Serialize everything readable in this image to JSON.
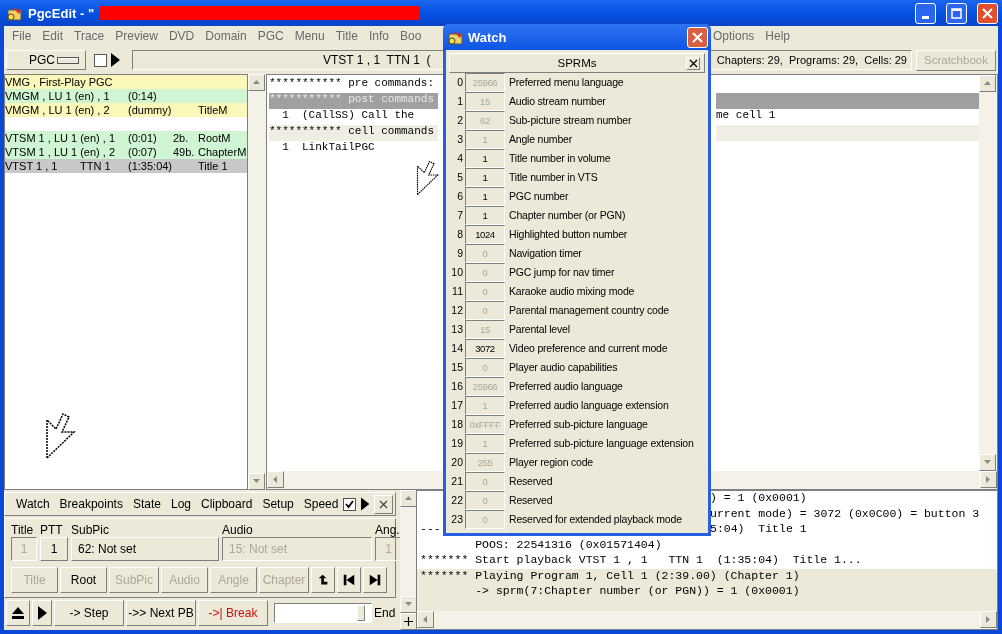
{
  "window": {
    "title": "PgcEdit - \"",
    "redacted": true
  },
  "menu": {
    "items": [
      "File",
      "Edit",
      "Trace",
      "Preview",
      "DVD",
      "Domain",
      "PGC",
      "Menu",
      "Title",
      "Info",
      "Boo"
    ],
    "items_right": [
      "Options",
      "Help"
    ]
  },
  "toolbar": {
    "domain_select": "PGC",
    "checked": false,
    "location": "VTST 1 , 1  TTN 1  (",
    "summary": "Chapters: 29,  Programs: 29,  Cells: 29",
    "scratchbook": {
      "label": "Scratchbook",
      "disabled": true
    }
  },
  "pgc_list": [
    {
      "name": "VMG , First-Play PGC",
      "color": "#fbf7b8",
      "selected": false
    },
    {
      "name": "VMGM , LU 1 (en) , 1",
      "duration": "(0:14)",
      "color": "#cff5d2",
      "selected": false
    },
    {
      "name": "VMGM , LU 1 (en) , 2",
      "duration": "(dummy)",
      "label": "TitleM",
      "color": "#fbf7b8",
      "selected": false
    },
    {
      "name": "VTSM 1 , LU 1 (en) , 1",
      "duration": "(0:01)",
      "size": "2b.",
      "label": "RootM",
      "color": "#cff5d2",
      "selected": false,
      "gap_before": true
    },
    {
      "name": "VTSM 1 , LU 1 (en) , 2",
      "duration": "(0:07)",
      "size": "49b.",
      "label": "ChapterM",
      "color": "#cff5d2",
      "selected": false
    },
    {
      "name": "VTST 1 , 1",
      "ttn": "TTN 1",
      "duration": "(1:35:04)",
      "label": "Title 1",
      "selected": true
    }
  ],
  "commands": [
    {
      "text": "*********** pre commands:",
      "selected": false,
      "current": false
    },
    {
      "text": "*********** post commands",
      "selected": true,
      "current": false
    },
    {
      "text": "  1  (CallSS) Call the",
      "text_right": "me cell 1",
      "selected": false,
      "current": false
    },
    {
      "text": "*********** cell commands",
      "selected": false,
      "current": true
    },
    {
      "text": "  1  LinkTailPGC",
      "selected": false,
      "current": false
    }
  ],
  "control_panel": {
    "tabs": [
      "Watch",
      "Breakpoints",
      "State",
      "Log",
      "Clipboard",
      "Setup",
      "Speed"
    ],
    "auto_checked": true,
    "fields": [
      {
        "label": "Title",
        "value": "1",
        "disabled": true
      },
      {
        "label": "PTT",
        "value": "1",
        "disabled": false
      },
      {
        "label": "SubPic",
        "value": "62: Not set",
        "disabled": false
      },
      {
        "label": "Audio",
        "value": "15: Not set",
        "disabled": true
      },
      {
        "label": "Ang.",
        "value": "1",
        "disabled": true
      }
    ],
    "buttons": [
      {
        "kind": "text",
        "label": "Title",
        "disabled": true
      },
      {
        "kind": "text",
        "label": "Root",
        "disabled": false
      },
      {
        "kind": "text",
        "label": "SubPic",
        "disabled": true
      },
      {
        "kind": "text",
        "label": "Audio",
        "disabled": true
      },
      {
        "kind": "text",
        "label": "Angle",
        "disabled": true
      },
      {
        "kind": "text",
        "label": "Chapter",
        "disabled": true
      },
      {
        "kind": "return",
        "disabled": false
      },
      {
        "kind": "prev",
        "disabled": false
      },
      {
        "kind": "next",
        "disabled": false
      }
    ],
    "transport": [
      {
        "kind": "eject"
      },
      {
        "kind": "play"
      },
      {
        "kind": "text",
        "label": "-> Step"
      },
      {
        "kind": "text",
        "label": "->> Next PB"
      },
      {
        "kind": "break",
        "label": "->| Break"
      }
    ],
    "speed": {
      "level": 0.93,
      "label": "End"
    }
  },
  "log": [
    {
      "text_right": ") = 1 (0x0001)",
      "current": false
    },
    {
      "text_right": "urrent mode) = 3072 (0x0C00) = button 3",
      "current": false
    },
    {
      "text": "---",
      "text_right": "5:04)  Title 1",
      "current": false
    },
    {
      "text": "        POOS: 22541316 (0x01571404)",
      "current": false
    },
    {
      "text": "******* Start playback VTST 1 , 1   TTN 1  (1:35:04)  Title 1...",
      "current": false
    },
    {
      "text": "******* Playing Program 1, Cell 1 (2:39.00) (Chapter 1)",
      "current": true
    },
    {
      "text": "        -> sprm(7:Chapter number (or PGN)) = 1 (0x0001)",
      "current": true
    }
  ],
  "watch": {
    "title": "Watch",
    "panel_title": "SPRMs",
    "rows": [
      {
        "index": "0",
        "value": "25966",
        "label": "Preferred menu language",
        "active": false
      },
      {
        "index": "1",
        "value": "15",
        "label": "Audio stream number",
        "active": false
      },
      {
        "index": "2",
        "value": "62",
        "label": "Sub-picture stream number",
        "active": false
      },
      {
        "index": "3",
        "value": "1",
        "label": "Angle number",
        "active": false
      },
      {
        "index": "4",
        "value": "1",
        "label": "Title number in volume",
        "active": true
      },
      {
        "index": "5",
        "value": "1",
        "label": "Title number in VTS",
        "active": true
      },
      {
        "index": "6",
        "value": "1",
        "label": "PGC number",
        "active": true
      },
      {
        "index": "7",
        "value": "1",
        "label": "Chapter number (or PGN)",
        "active": true
      },
      {
        "index": "8",
        "value": "1024",
        "label": "Highlighted button number",
        "active": true
      },
      {
        "index": "9",
        "value": "0",
        "label": "Navigation timer",
        "active": false
      },
      {
        "index": "10",
        "value": "0",
        "label": "PGC jump for nav timer",
        "active": false
      },
      {
        "index": "11",
        "value": "0",
        "label": "Karaoke audio mixing mode",
        "active": false
      },
      {
        "index": "12",
        "value": "0",
        "label": "Parental management country code",
        "active": false
      },
      {
        "index": "13",
        "value": "15",
        "label": "Parental level",
        "active": false
      },
      {
        "index": "14",
        "value": "3072",
        "label": "Video preference and current mode",
        "active": true
      },
      {
        "index": "15",
        "value": "0",
        "label": "Player audio capabilities",
        "active": false
      },
      {
        "index": "16",
        "value": "25966",
        "label": "Preferred audio language",
        "active": false
      },
      {
        "index": "17",
        "value": "1",
        "label": "Preferred audio language extension",
        "active": false
      },
      {
        "index": "18",
        "value": "0xFFFF",
        "label": "Preferred sub-picture language",
        "active": false
      },
      {
        "index": "19",
        "value": "1",
        "label": "Preferred sub-picture language extension",
        "active": false
      },
      {
        "index": "20",
        "value": "255",
        "label": "Player region code",
        "active": false
      },
      {
        "index": "21",
        "value": "0",
        "label": "Reserved",
        "active": false
      },
      {
        "index": "22",
        "value": "0",
        "label": "Reserved",
        "active": false
      },
      {
        "index": "23",
        "value": "0",
        "label": "Reserved for extended playback mode",
        "active": false
      }
    ]
  }
}
